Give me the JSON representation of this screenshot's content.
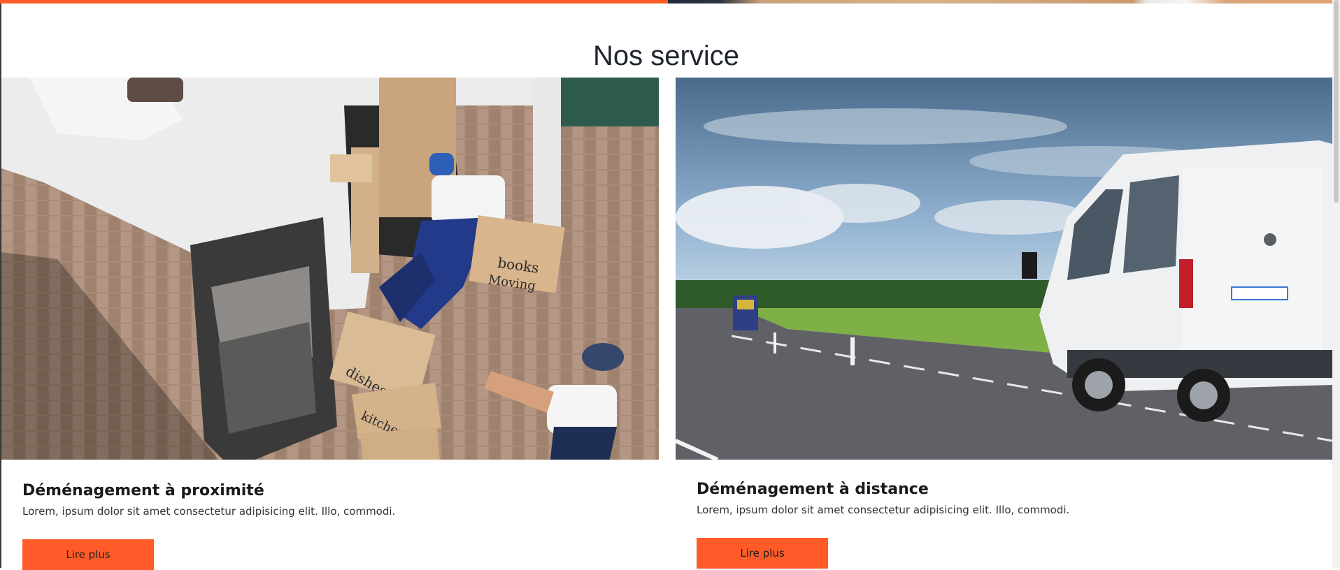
{
  "section": {
    "title": "Nos service"
  },
  "cards": [
    {
      "title": "Déménagement à proximité",
      "text": "Lorem, ipsum dolor sit amet consectetur adipisicing elit. Illo, commodi.",
      "button_label": "Lire plus",
      "image_label": "movers-loading-boxes-photo"
    },
    {
      "title": "Déménagement à distance",
      "text": "Lorem, ipsum dolor sit amet consectetur adipisicing elit. Illo, commodi.",
      "button_label": "Lire plus",
      "image_label": "white-van-on-road-photo"
    }
  ],
  "box_labels": [
    "books",
    "Moving",
    "dishes",
    "kitchen"
  ],
  "colors": {
    "accent": "#ff5a27",
    "title": "#1f2430"
  }
}
